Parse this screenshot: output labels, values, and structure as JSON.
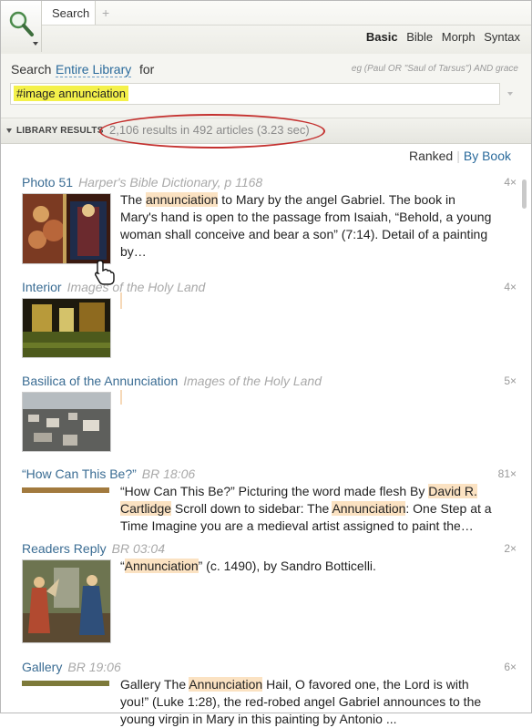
{
  "tab": {
    "label": "Search",
    "add": "+"
  },
  "modes": [
    "Basic",
    "Bible",
    "Morph",
    "Syntax"
  ],
  "search": {
    "label": "Search",
    "scope": "Entire Library",
    "for_label": "for",
    "example": "eg (Paul OR \"Saul of Tarsus\") AND grace",
    "query": "#image annunciation"
  },
  "results_header": {
    "section": "LIBRARY RESULTS",
    "count_text": "2,106 results in 492 articles (3.23 sec)"
  },
  "sort": {
    "ranked": "Ranked",
    "by_book": "By Book"
  },
  "results": [
    {
      "title": "Photo 51",
      "source": "Harper's Bible Dictionary, p 1168",
      "count": "4×",
      "snippet": [
        " The ",
        {
          "hl": "annunciation"
        },
        " to Mary by the angel Gabriel. The book in Mary's hand is open to the passage from Isaiah, “Behold, a young woman shall conceive and bear a son” (7:14). Detail of a painting by…"
      ]
    },
    {
      "title": "Interior",
      "source": "Images of the Holy Land",
      "count": "4×",
      "snippet": []
    },
    {
      "title": "Basilica of the Annunciation",
      "source": "Images of the Holy Land",
      "count": "5×",
      "snippet": []
    },
    {
      "title": "“How Can This Be?”",
      "source": "BR 18:06",
      "count": "81×",
      "snippet": [
        " “How Can This Be?” Picturing the word made flesh By ",
        {
          "hl": "David R. Cartlidge"
        },
        " Scroll down to sidebar: The ",
        {
          "hl": "Annunciation"
        },
        ": One Step at a Time  Imagine you are a medieval artist assigned to paint the…"
      ]
    },
    {
      "title": "Readers Reply",
      "source": "BR 03:04",
      "count": "2×",
      "snippet": [
        " “",
        {
          "hl": "Annunciation"
        },
        "” (c. 1490), by Sandro Botticelli."
      ]
    },
    {
      "title": "Gallery",
      "source": "BR 19:06",
      "count": "6×",
      "snippet": [
        " Gallery The ",
        {
          "hl": "Annunciation"
        },
        "  Hail, O favored one, the Lord is with you!” (Luke 1:28), the red-robed angel Gabriel announces to the young virgin in Mary in this painting by Antonio ..."
      ]
    }
  ],
  "colors": {
    "accent": "#2a6a9b",
    "highlight": "#f4f14a",
    "match": "#fbe2c2",
    "annotation": "#c4312f"
  }
}
